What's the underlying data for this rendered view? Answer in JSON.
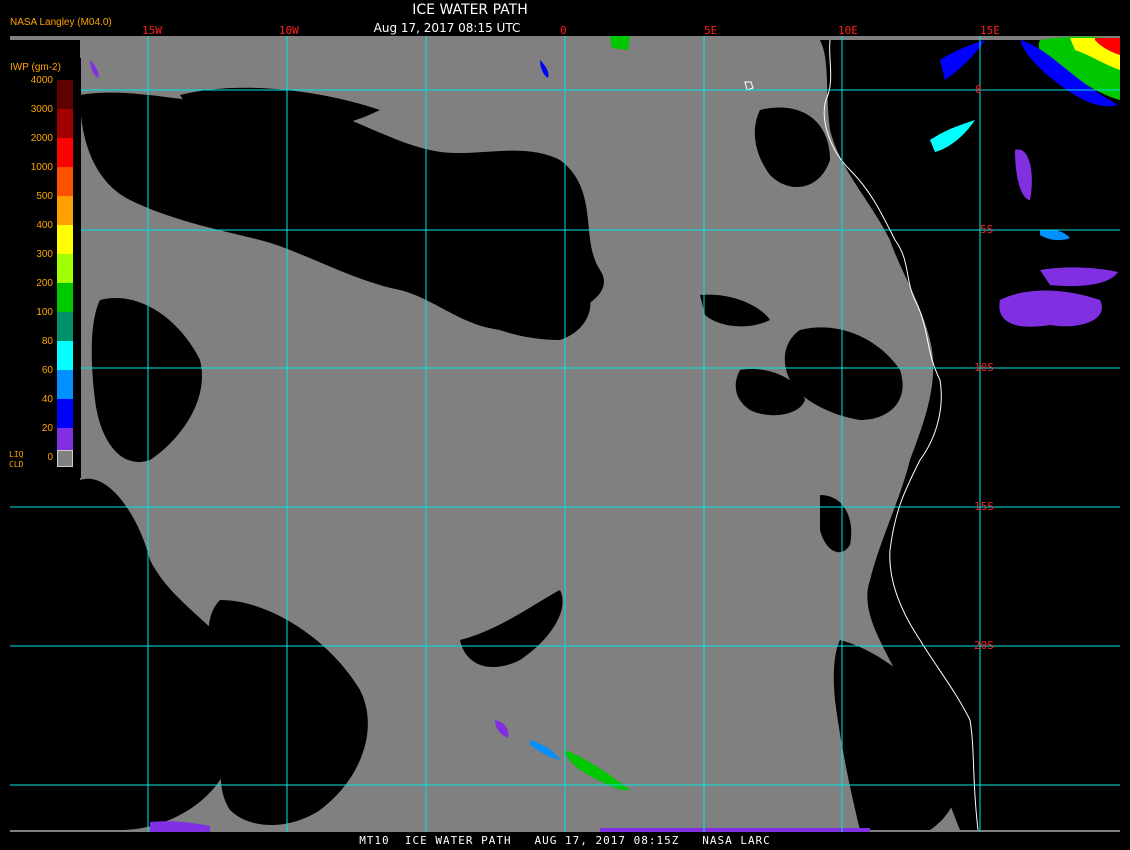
{
  "header": {
    "title": "ICE WATER PATH",
    "datetime": "Aug 17, 2017 08:15 UTC",
    "org": "NASA Langley (M04.0)"
  },
  "grid": {
    "lon_labels": [
      "15W",
      "10W",
      "0",
      "5E",
      "10E",
      "15E"
    ],
    "lat_labels": [
      "0",
      "5S",
      "10S",
      "15S",
      "20S"
    ],
    "grid_color": "#00e5e5",
    "label_color": "#ff2020"
  },
  "legend": {
    "title": "IWP (gm-2)",
    "levels": [
      {
        "label": "4000",
        "color": "#600000"
      },
      {
        "label": "3000",
        "color": "#a00000"
      },
      {
        "label": "2000",
        "color": "#ff0000"
      },
      {
        "label": "1000",
        "color": "#ff5000"
      },
      {
        "label": "500",
        "color": "#ffa000"
      },
      {
        "label": "400",
        "color": "#ffff00"
      },
      {
        "label": "300",
        "color": "#a0ff00"
      },
      {
        "label": "200",
        "color": "#00c800"
      },
      {
        "label": "100",
        "color": "#00906a"
      },
      {
        "label": "80",
        "color": "#00ffff"
      },
      {
        "label": "60",
        "color": "#0090ff"
      },
      {
        "label": "40",
        "color": "#0000ff"
      },
      {
        "label": "20",
        "color": "#8030e0"
      },
      {
        "label": "0",
        "color": ""
      }
    ],
    "liquid_label_line1": "LIQ",
    "liquid_label_line2": "CLD",
    "liquid_color": "#808080"
  },
  "footer": "MT10  ICE WATER PATH   AUG 17, 2017 08:15Z   NASA LARC"
}
